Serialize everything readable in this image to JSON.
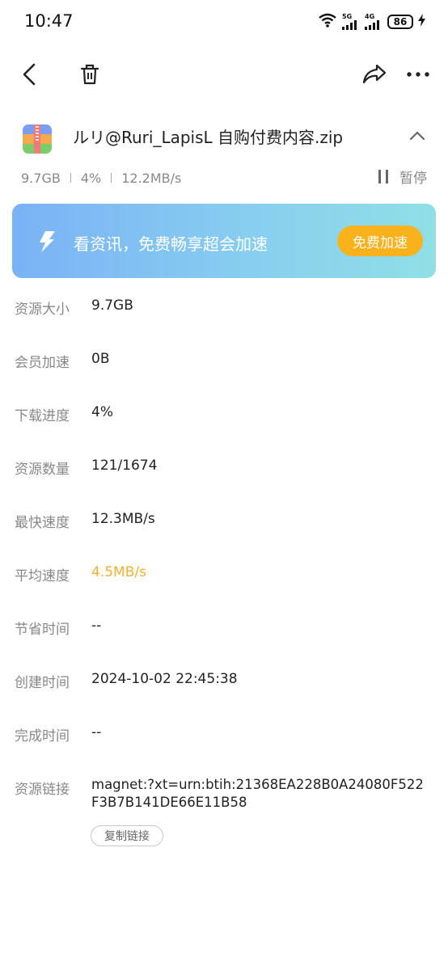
{
  "status_bar": {
    "time": "10:47",
    "net1": "5G",
    "net2": "4G",
    "battery": "86"
  },
  "file": {
    "name": "ルリ@Ruri_LapisL 自购付费内容.zip",
    "size": "9.7GB",
    "percent": "4%",
    "speed": "12.2MB/s",
    "pause_label": "暂停"
  },
  "banner": {
    "text": "看资讯，免费畅享超会加速",
    "button_label": "免费加速"
  },
  "details": [
    {
      "label": "资源大小",
      "value": "9.7GB"
    },
    {
      "label": "会员加速",
      "value": "0B"
    },
    {
      "label": "下载进度",
      "value": "4%"
    },
    {
      "label": "资源数量",
      "value": "121/1674"
    },
    {
      "label": "最快速度",
      "value": "12.3MB/s"
    },
    {
      "label": "平均速度",
      "value": "4.5MB/s"
    },
    {
      "label": "节省时间",
      "value": "--"
    },
    {
      "label": "创建时间",
      "value": "2024-10-02 22:45:38"
    },
    {
      "label": "完成时间",
      "value": "--"
    }
  ],
  "link": {
    "label": "资源链接",
    "value": "magnet:?xt=urn:btih:21368EA228B0A24080F522F3B7B141DE66E11B58",
    "copy_label": "复制链接"
  },
  "colors": {
    "accent": "#F4B030",
    "boost_button": "#F9B21C",
    "banner_start": "#7AB2F5",
    "banner_end": "#90DFE6"
  }
}
